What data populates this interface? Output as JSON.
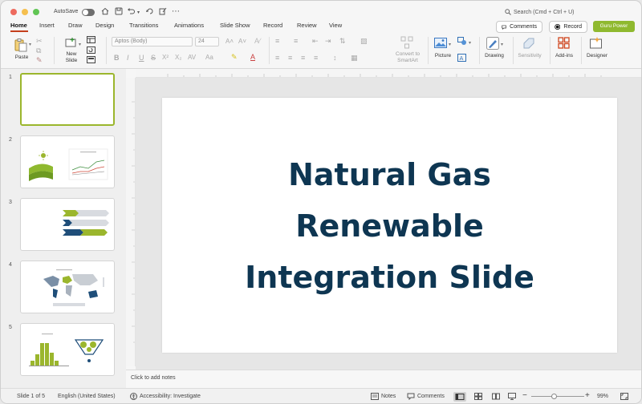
{
  "window": {
    "autosave_label": "AutoSave",
    "search_placeholder": "Search (Cmd + Ctrl + U)"
  },
  "tabs": [
    "Home",
    "Insert",
    "Draw",
    "Design",
    "Transitions",
    "Animations",
    "Slide Show",
    "Record",
    "Review",
    "View"
  ],
  "active_tab": "Home",
  "header_buttons": {
    "comments": "Comments",
    "record": "Record",
    "guru_power": "Guru Power"
  },
  "ribbon": {
    "paste": "Paste",
    "new_slide": "New Slide",
    "font_name": "Aptos (Body)",
    "font_size": "24",
    "convert_smartart": "Convert to SmartArt",
    "picture": "Picture",
    "drawing": "Drawing",
    "sensitivity": "Sensitivity",
    "add_ins": "Add-ins",
    "designer": "Designer"
  },
  "slides": [
    {
      "number": "1",
      "selected": true
    },
    {
      "number": "2",
      "selected": false
    },
    {
      "number": "3",
      "selected": false
    },
    {
      "number": "4",
      "selected": false
    },
    {
      "number": "5",
      "selected": false
    }
  ],
  "main_slide": {
    "title_lines": [
      "Natural Gas",
      "Renewable",
      "Integration Slide"
    ],
    "title_color": "#0e3652"
  },
  "notes_placeholder": "Click to add notes",
  "status_bar": {
    "slide_position": "Slide 1 of 5",
    "language": "English (United States)",
    "accessibility": "Accessibility: Investigate",
    "notes": "Notes",
    "comments": "Comments",
    "zoom": "99%"
  },
  "colors": {
    "accent_red": "#c43e1c",
    "brand_green": "#8fb92f",
    "thumb_green": "#9bb62d",
    "navy": "#0e3652"
  }
}
